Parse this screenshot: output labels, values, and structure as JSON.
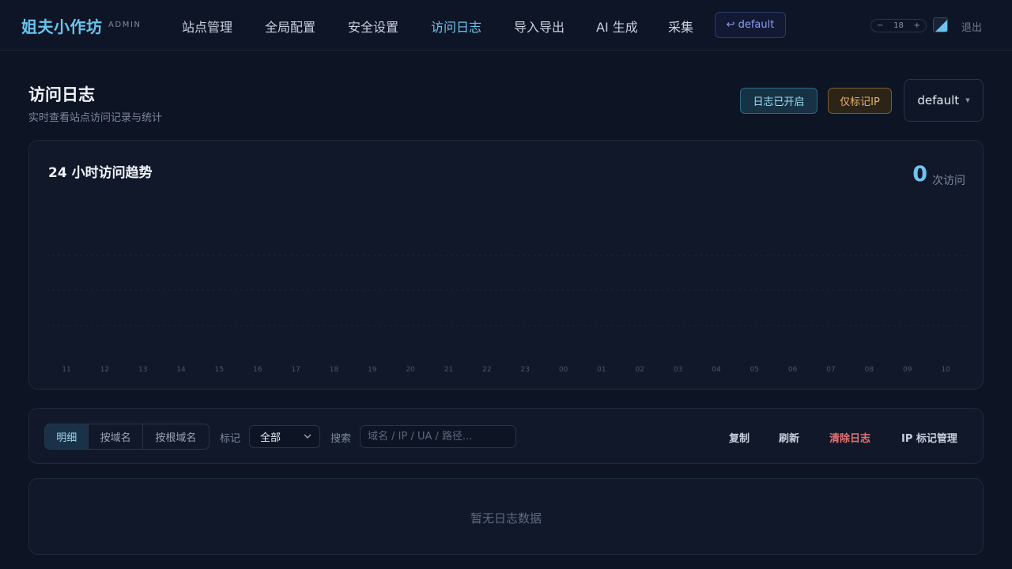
{
  "brand": {
    "name": "姐夫小作坊",
    "sub": "ADMIN"
  },
  "nav": {
    "items": [
      "站点管理",
      "全局配置",
      "安全设置",
      "访问日志",
      "导入导出",
      "AI 生成",
      "采集"
    ],
    "active_index": 3,
    "default_button": "default",
    "font_size_value": "18",
    "stepper_minus": "−",
    "stepper_plus": "+",
    "logout": "退出"
  },
  "header": {
    "title": "访问日志",
    "subtitle": "实时查看站点访问记录与统计",
    "log_badge": "日志已开启",
    "ip_badge": "仅标记IP",
    "site_select": "default"
  },
  "chart": {
    "title": "24 小时访问趋势",
    "total": "0",
    "total_unit": "次访问"
  },
  "chart_data": {
    "type": "bar",
    "categories": [
      "11",
      "12",
      "13",
      "14",
      "15",
      "16",
      "17",
      "18",
      "19",
      "20",
      "21",
      "22",
      "23",
      "00",
      "01",
      "02",
      "03",
      "04",
      "05",
      "06",
      "07",
      "08",
      "09",
      "10"
    ],
    "values": [
      0,
      0,
      0,
      0,
      0,
      0,
      0,
      0,
      0,
      0,
      0,
      0,
      0,
      0,
      0,
      0,
      0,
      0,
      0,
      0,
      0,
      0,
      0,
      0
    ],
    "title": "24 小时访问趋势",
    "grid": true
  },
  "toolbar": {
    "tabs": [
      "明细",
      "按域名",
      "按根域名"
    ],
    "active_tab": 0,
    "mark_label": "标记",
    "mark_value": "全部",
    "search_label": "搜索",
    "search_placeholder": "域名 / IP / UA / 路径...",
    "copy": "复制",
    "refresh": "刷新",
    "clear": "清除日志",
    "ip_manage": "IP 标记管理"
  },
  "empty": {
    "text": "暂无日志数据"
  },
  "colors": {
    "accent": "#6cc4ee",
    "background": "#0d1424",
    "danger": "#e57373",
    "warn": "#e8b46a"
  }
}
